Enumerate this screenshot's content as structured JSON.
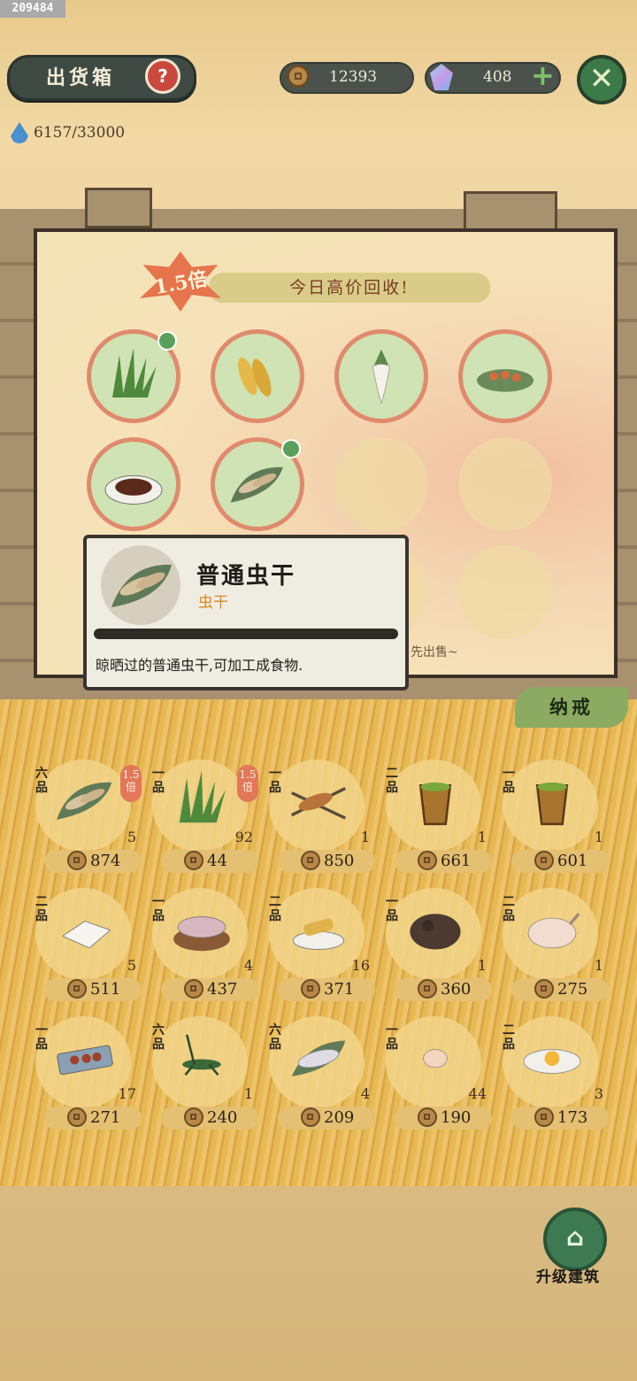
{
  "watermark": "209484",
  "header": {
    "title": "出货箱",
    "help_glyph": "?",
    "coins": "12393",
    "gems": "408",
    "plus_glyph": "+",
    "close_glyph": "✕"
  },
  "water": "6157/33000",
  "board": {
    "multiplier": "1.5倍",
    "banner": "今日高价回收!",
    "slots": [
      {
        "item": "grass",
        "filled": true,
        "marked": true
      },
      {
        "item": "corn",
        "filled": true,
        "marked": false
      },
      {
        "item": "radish",
        "filled": true,
        "marked": false
      },
      {
        "item": "dish",
        "filled": true,
        "marked": false
      },
      {
        "item": "braised-dish",
        "filled": true,
        "marked": false
      },
      {
        "item": "dried-insect",
        "filled": true,
        "marked": true
      },
      {
        "item": "",
        "filled": false
      },
      {
        "item": "",
        "filled": false
      },
      {
        "item": "",
        "filled": false
      },
      {
        "item": "",
        "filled": false
      }
    ],
    "hint": "先出售~"
  },
  "tooltip": {
    "name": "普通虫干",
    "type": "虫干",
    "description": "晾晒过的普通虫干,可加工成食物."
  },
  "nanjie_label": "纳戒",
  "inventory": [
    {
      "grade": "六品",
      "count": "5",
      "price": "874",
      "mult": "1.5倍",
      "item": "dried-insect"
    },
    {
      "grade": "一品",
      "count": "92",
      "price": "44",
      "mult": "1.5倍",
      "item": "grass"
    },
    {
      "grade": "一品",
      "count": "1",
      "price": "850",
      "mult": "",
      "item": "skewer"
    },
    {
      "grade": "二品",
      "count": "1",
      "price": "661",
      "mult": "",
      "item": "tea-cup"
    },
    {
      "grade": "一品",
      "count": "1",
      "price": "601",
      "mult": "",
      "item": "tea-cup"
    },
    {
      "grade": "二品",
      "count": "5",
      "price": "511",
      "mult": "",
      "item": "tofu"
    },
    {
      "grade": "一品",
      "count": "4",
      "price": "437",
      "mult": "",
      "item": "fish-board"
    },
    {
      "grade": "二品",
      "count": "16",
      "price": "371",
      "mult": "",
      "item": "spring-roll"
    },
    {
      "grade": "一品",
      "count": "1",
      "price": "360",
      "mult": "",
      "item": "truffle"
    },
    {
      "grade": "二品",
      "count": "1",
      "price": "275",
      "mult": "",
      "item": "chicken"
    },
    {
      "grade": "一品",
      "count": "17",
      "price": "271",
      "mult": "",
      "item": "tray-dish"
    },
    {
      "grade": "六品",
      "count": "1",
      "price": "240",
      "mult": "",
      "item": "cricket"
    },
    {
      "grade": "六品",
      "count": "4",
      "price": "209",
      "mult": "",
      "item": "fish-leaf"
    },
    {
      "grade": "一品",
      "count": "44",
      "price": "190",
      "mult": "",
      "item": "egg"
    },
    {
      "grade": "二品",
      "count": "3",
      "price": "173",
      "mult": "",
      "item": "fried-egg"
    }
  ],
  "upgrade_label": "升级建筑",
  "colors": {
    "accent_red": "#e2775a",
    "accent_green": "#3d7a52",
    "dark_pill": "#4a524b"
  }
}
